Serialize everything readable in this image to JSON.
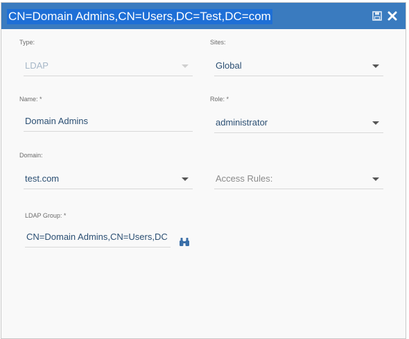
{
  "window": {
    "title": "CN=Domain Admins,CN=Users,DC=Test,DC=com"
  },
  "form": {
    "type": {
      "label": "Type:",
      "value": "LDAP"
    },
    "sites": {
      "label": "Sites:",
      "value": "Global"
    },
    "name": {
      "label": "Name: *",
      "value": "Domain Admins"
    },
    "role": {
      "label": "Role: *",
      "value": "administrator"
    },
    "domain": {
      "label": "Domain:",
      "value": "test.com"
    },
    "access_rules": {
      "placeholder": "Access Rules:"
    },
    "ldap_group": {
      "label": "LDAP Group: *",
      "value": "CN=Domain Admins,CN=Users,DC"
    }
  },
  "icons": {
    "save": "save-icon",
    "close": "close-icon",
    "browse": "binoculars-icon"
  },
  "colors": {
    "titlebar": "#3a7bbf",
    "title_highlight": "#1e6fd6",
    "value_text": "#2b4f73"
  }
}
